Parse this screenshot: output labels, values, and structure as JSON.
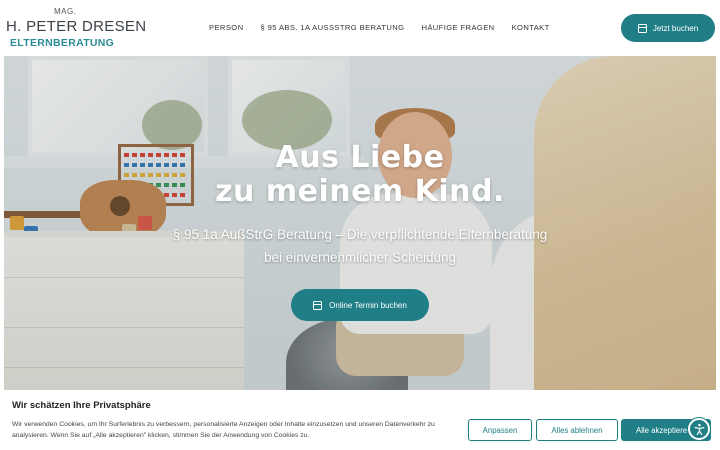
{
  "logo": {
    "mag": "MAG.",
    "name": "H. PETER DRESEN",
    "sub": "ELTERNBERATUNG"
  },
  "nav": {
    "items": [
      {
        "label": "PERSON"
      },
      {
        "label": "§ 95 ABS. 1A AUSSSTRG BERATUNG"
      },
      {
        "label": "HÄUFIGE FRAGEN"
      },
      {
        "label": "KONTAKT"
      }
    ]
  },
  "header": {
    "book_label": "Jetzt buchen",
    "book_icon": "calendar-icon"
  },
  "hero": {
    "title_line1": "Aus Liebe",
    "title_line2": "zu meinem Kind.",
    "subtitle_line1": "§ 95 1a AußStrG Beratung – Die verpflichtende Elternberatung",
    "subtitle_line2": "bei einvernehmlicher Scheidung",
    "cta_label": "Online Termin buchen",
    "cta_icon": "calendar-icon"
  },
  "cookie": {
    "title": "Wir schätzen Ihre Privatsphäre",
    "text": "Wir verwenden Cookies, um Ihr Surferlebnis zu verbessern, personalisierte Anzeigen oder Inhalte einzusetzen und unseren Datenverkehr zu analysieren. Wenn Sie auf „Alle akzeptieren\" klicken, stimmen Sie der Anwendung von Cookies zu.",
    "customize_label": "Anpassen",
    "reject_label": "Alles ablehnen",
    "accept_label": "Alle akzeptiere"
  },
  "accessibility": {
    "icon": "accessibility-icon"
  },
  "colors": {
    "accent": "#1f7e86",
    "logo_sub": "#2b8c95",
    "text_dark": "#2f363b"
  }
}
